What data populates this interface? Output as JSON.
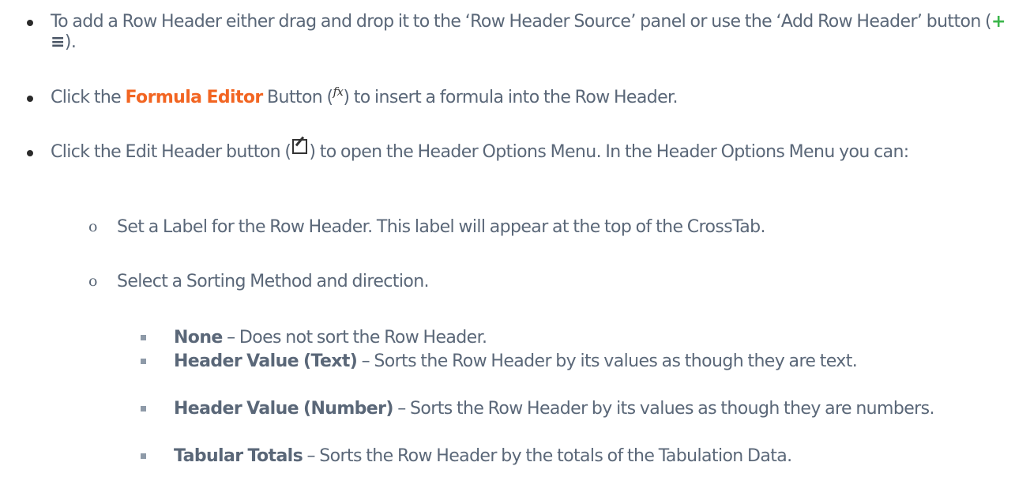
{
  "items": [
    {
      "pre": "To add a Row Header either drag and drop it to the ‘Row Header Source’ panel or use the ‘Add Row Header’ button (",
      "plus": "+",
      "menu": "≡",
      "post": ")."
    },
    {
      "pre": "Click the ",
      "emph": "Formula Editor",
      "mid": " Button (",
      "fx": "fx",
      "post": ") to insert a formula into the Row Header."
    },
    {
      "pre": "Click the Edit Header button (",
      "post": ") to open the Header Options Menu. In the Header Options Menu you can:"
    }
  ],
  "sub_items": [
    {
      "marker": "o",
      "text": "Set a Label for the Row Header. This label will appear at the top of the CrossTab."
    },
    {
      "marker": "o",
      "text": "Select a Sorting Method and direction."
    }
  ],
  "sort_options": [
    {
      "term": "None",
      "desc": " – Does not sort the Row Header."
    },
    {
      "term": "Header Value (Text)",
      "desc": " – Sorts the Row Header by its values as though they are text."
    },
    {
      "term": "Header Value (Number)",
      "desc": " – Sorts the Row Header by its values as though they are numbers."
    },
    {
      "term": "Tabular Totals",
      "desc": " – Sorts the Row Header by the totals of the Tabulation Data."
    }
  ],
  "colors": {
    "body_text": "#5a6778",
    "highlight": "#f26522",
    "add_icon": "#3ab54a"
  },
  "icons": [
    "add-icon",
    "list-icon",
    "formula-icon",
    "edit-icon"
  ]
}
